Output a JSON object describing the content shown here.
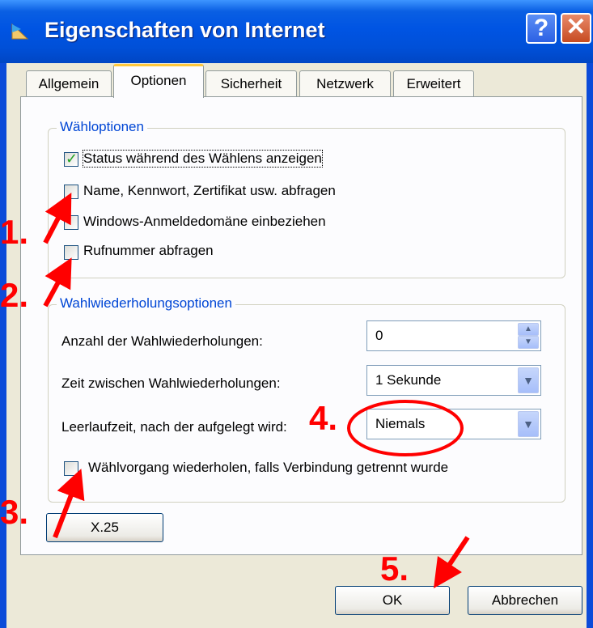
{
  "window": {
    "title": "Eigenschaften von Internet",
    "help_glyph": "?",
    "close_glyph": "✕"
  },
  "tabs": [
    {
      "label": "Allgemein",
      "active": false
    },
    {
      "label": "Optionen",
      "active": true
    },
    {
      "label": "Sicherheit",
      "active": false
    },
    {
      "label": "Netzwerk",
      "active": false
    },
    {
      "label": "Erweitert",
      "active": false
    }
  ],
  "dial_options": {
    "legend": "Wähloptionen",
    "items": [
      {
        "label": "Status während des Wählens anzeigen",
        "checked": true
      },
      {
        "label": "Name, Kennwort, Zertifikat usw. abfragen",
        "checked": false
      },
      {
        "label": "Windows-Anmeldedomäne einbeziehen",
        "checked": false
      },
      {
        "label": "Rufnummer abfragen",
        "checked": false
      }
    ]
  },
  "redial_options": {
    "legend": "Wahlwiederholungsoptionen",
    "attempts_label": "Anzahl der Wahlwiederholungen:",
    "attempts_value": "0",
    "interval_label": "Zeit zwischen Wahlwiederholungen:",
    "interval_value": "1 Sekunde",
    "idle_label": "Leerlaufzeit, nach der aufgelegt wird:",
    "idle_value": "Niemals",
    "redial_checkbox_label": "Wählvorgang wiederholen, falls Verbindung getrennt wurde",
    "redial_checked": false
  },
  "buttons": {
    "x25": "X.25",
    "ok": "OK",
    "cancel": "Abbrechen"
  },
  "annotations": {
    "step1": "1.",
    "step2": "2.",
    "step3": "3.",
    "step4": "4.",
    "step5": "5.",
    "color": "#ff0000"
  },
  "colors": {
    "titlebar": "#0054e3",
    "group_legend": "#0046d5",
    "dialog_bg": "#ece9d8"
  }
}
